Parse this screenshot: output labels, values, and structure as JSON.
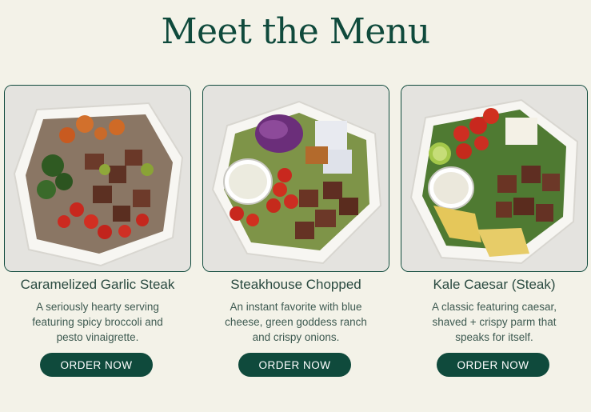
{
  "page": {
    "title": "Meet the Menu"
  },
  "menu": [
    {
      "name": "Caramelized Garlic Steak",
      "description": "A seriously hearty serving featuring spicy broccoli and pesto vinaigrette.",
      "button": "ORDER NOW"
    },
    {
      "name": "Steakhouse Chopped",
      "description": "An instant favorite with blue cheese, green goddess ranch and crispy onions.",
      "button": "ORDER NOW"
    },
    {
      "name": "Kale Caesar (Steak)",
      "description": "A classic featuring caesar, shaved + crispy parm that speaks for itself.",
      "button": "ORDER NOW"
    }
  ],
  "colors": {
    "background": "#f3f2e8",
    "accent": "#0f4a3c"
  }
}
